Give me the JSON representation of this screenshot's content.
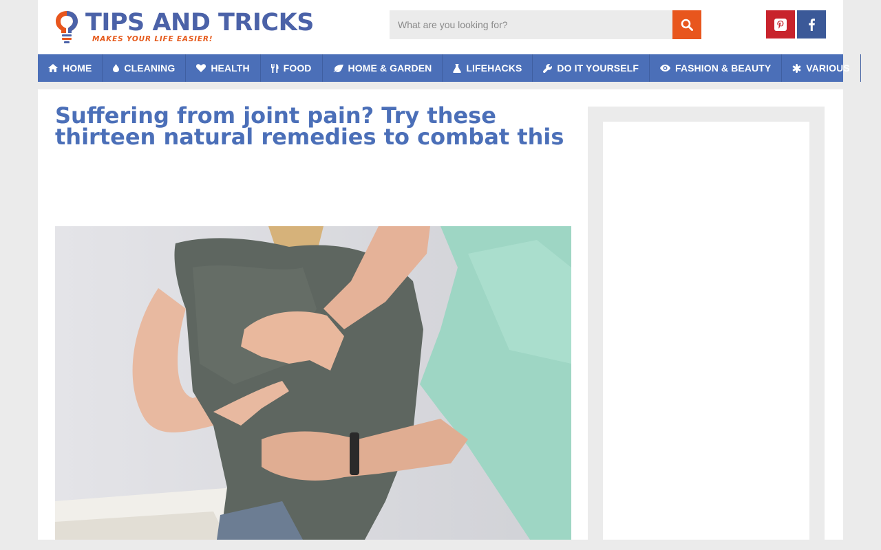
{
  "brand": {
    "title": "TIPS AND TRICKS",
    "tagline": "MAKES YOUR LIFE EASIER!",
    "colors": {
      "primary": "#4b6fb8",
      "accent": "#e8561d"
    }
  },
  "search": {
    "placeholder": "What are you looking for?",
    "value": "",
    "button_icon": "search-icon"
  },
  "social": [
    {
      "name": "pinterest",
      "icon": "pinterest-icon",
      "color": "#c8232c"
    },
    {
      "name": "facebook",
      "icon": "facebook-icon",
      "color": "#3b5998"
    }
  ],
  "nav": {
    "items": [
      {
        "label": "HOME",
        "icon": "home-icon"
      },
      {
        "label": "CLEANING",
        "icon": "drop-icon"
      },
      {
        "label": "HEALTH",
        "icon": "heart-icon"
      },
      {
        "label": "FOOD",
        "icon": "cutlery-icon"
      },
      {
        "label": "HOME & GARDEN",
        "icon": "leaf-icon"
      },
      {
        "label": "LIFEHACKS",
        "icon": "flask-icon"
      },
      {
        "label": "DO IT YOURSELF",
        "icon": "wrench-icon"
      },
      {
        "label": "FASHION & BEAUTY",
        "icon": "eye-icon"
      },
      {
        "label": "VARIOUS",
        "icon": "asterisk-icon"
      }
    ]
  },
  "article": {
    "title": "Suffering from joint pain? Try these thirteen natural remedies to combat this"
  }
}
